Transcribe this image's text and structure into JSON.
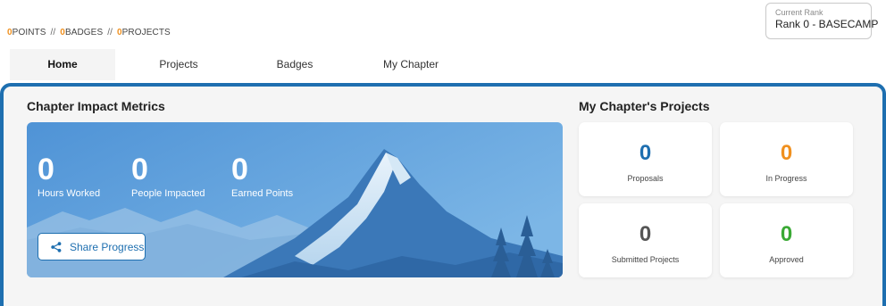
{
  "stats": {
    "points_value": "0",
    "points_label": "POINTS",
    "separator": "//",
    "badges_value": "0",
    "badges_label": "BADGES",
    "projects_value": "0",
    "projects_label": "PROJECTS"
  },
  "rank": {
    "label": "Current Rank",
    "value": "Rank 0 - BASECAMP"
  },
  "tabs": [
    {
      "label": "Home",
      "active": true
    },
    {
      "label": "Projects",
      "active": false
    },
    {
      "label": "Badges",
      "active": false
    },
    {
      "label": "My Chapter",
      "active": false
    }
  ],
  "impact": {
    "title": "Chapter Impact Metrics",
    "metrics": [
      {
        "value": "0",
        "label": "Hours Worked"
      },
      {
        "value": "0",
        "label": "People Impacted"
      },
      {
        "value": "0",
        "label": "Earned Points"
      }
    ],
    "share_label": "Share Progress",
    "share_icon": "share-icon"
  },
  "chapter_projects": {
    "title": "My Chapter's Projects",
    "cards": [
      {
        "value": "0",
        "label": "Proposals",
        "color": "#1e6fb0"
      },
      {
        "value": "0",
        "label": "In Progress",
        "color": "#f0901e"
      },
      {
        "value": "0",
        "label": "Submitted Projects",
        "color": "#555555"
      },
      {
        "value": "0",
        "label": "Approved",
        "color": "#3aa935"
      }
    ]
  },
  "colors": {
    "accent": "#1e6fb0",
    "orange": "#f0901e",
    "green": "#3aa935"
  }
}
